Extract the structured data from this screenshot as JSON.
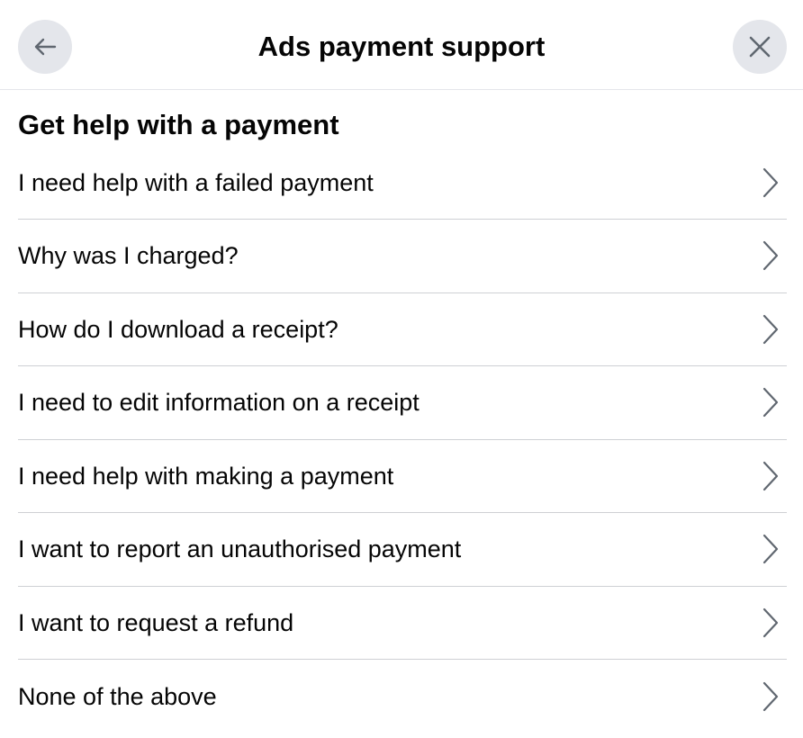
{
  "header": {
    "title": "Ads payment support",
    "back_icon": "arrow-left-icon",
    "close_icon": "close-icon"
  },
  "section": {
    "title": "Get help with a payment"
  },
  "items": [
    {
      "label": "I need help with a failed payment"
    },
    {
      "label": "Why was I charged?"
    },
    {
      "label": "How do I download a receipt?"
    },
    {
      "label": "I need to edit information on a receipt"
    },
    {
      "label": "I need help with making a payment"
    },
    {
      "label": "I want to report an unauthorised payment"
    },
    {
      "label": "I want to request a refund"
    },
    {
      "label": "None of the above"
    }
  ],
  "colors": {
    "button_bg": "#e4e6eb",
    "divider": "#ced0d4",
    "text": "#050505",
    "icon": "#606770"
  }
}
